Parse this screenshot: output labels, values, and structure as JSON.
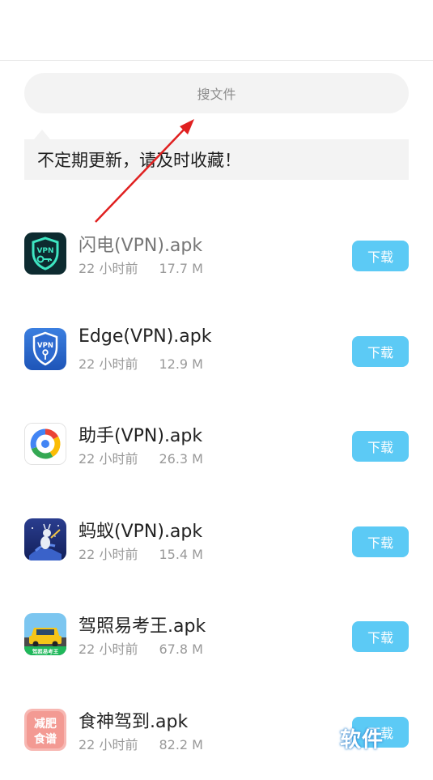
{
  "search": {
    "placeholder": "搜文件"
  },
  "tip": {
    "text": "不定期更新，请及时收藏！"
  },
  "colors": {
    "button": "#5ccaf5",
    "arrow": "#e02020",
    "background": "#ffffff",
    "field": "#f3f3f3"
  },
  "files": [
    {
      "name": "闪电(VPN).apk",
      "time": "22 小时前",
      "size": "17.7 M",
      "button": "下载",
      "icon": "vpn-shield-key-icon"
    },
    {
      "name": "Edge(VPN).apk",
      "time": "22 小时前",
      "size": "12.9 M",
      "button": "下载",
      "icon": "vpn-shield-blue-icon"
    },
    {
      "name": "助手(VPN).apk",
      "time": "22 小时前",
      "size": "26.3 M",
      "button": "下载",
      "icon": "colorful-ring-icon"
    },
    {
      "name": "蚂蚁(VPN).apk",
      "time": "22 小时前",
      "size": "15.4 M",
      "button": "下载",
      "icon": "ant-rocket-icon"
    },
    {
      "name": "驾照易考王.apk",
      "time": "22 小时前",
      "size": "67.8 M",
      "button": "下载",
      "icon": "taxi-car-icon"
    },
    {
      "name": "食神驾到.apk",
      "time": "22 小时前",
      "size": "82.2 M",
      "button": "下载",
      "icon": "diet-recipe-icon"
    }
  ],
  "icon_text": {
    "vpn": "VPN",
    "jiazhao": "驾照易考王",
    "shishen": "减肥食谱"
  },
  "watermark": "软件"
}
